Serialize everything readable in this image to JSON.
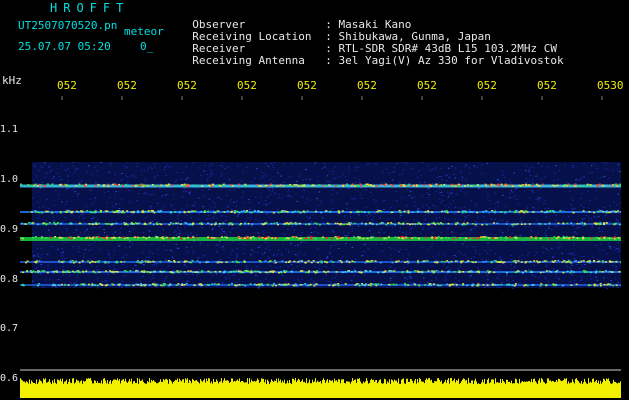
{
  "header": {
    "title": "HROFFT",
    "filename": "UT2507070520.pn",
    "type_label": "meteor",
    "datetime": "25.07.07 05:20",
    "subtype": "0_"
  },
  "info": [
    {
      "label": "Observer",
      "value": ": Masaki Kano"
    },
    {
      "label": "Receiving Location",
      "value": ": Shibukawa, Gunma, Japan"
    },
    {
      "label": "Receiver",
      "value": ": RTL-SDR SDR# 43dB L15 103.2MHz CW"
    },
    {
      "label": "Receiving Antenna",
      "value": ": 3el Yagi(V) Az 330 for Vladivostok"
    }
  ],
  "axis": {
    "unit": "kHz",
    "freq_labels": [
      "1.1",
      "1.0",
      "0.9",
      "0.8",
      "0.7",
      "0.6"
    ],
    "time_ticks": [
      "052",
      "052",
      "052",
      "052",
      "052",
      "052",
      "052",
      "052",
      "052",
      "0530"
    ]
  },
  "colors": {
    "background": "#000000",
    "title": "#00e0e0",
    "ticks": "#f0f000",
    "noise": "#1a2aa8",
    "strong_signal": "#ff2020",
    "signal_mid": "#20e040",
    "level_meter": "#f0f000"
  }
}
